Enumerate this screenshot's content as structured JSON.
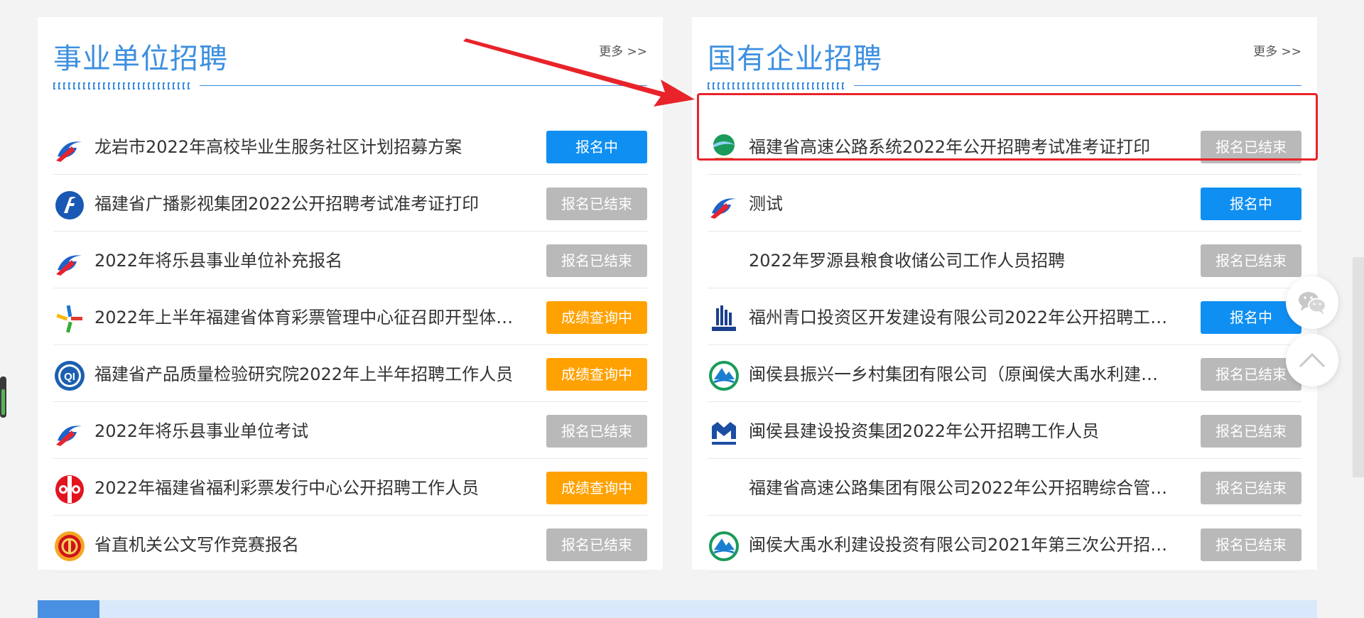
{
  "colors": {
    "brand_blue": "#3d8fe0",
    "status_open": "#0f8ff2",
    "status_ended": "#b9b9b9",
    "status_score": "#ffa100",
    "annotation_red": "#e8232a"
  },
  "panels": {
    "left": {
      "title": "事业单位招聘",
      "more": "更多 >>",
      "items": [
        {
          "title": "龙岩市2022年高校毕业生服务社区计划招募方案",
          "status": "报名中",
          "icon": "blue-red-swoosh-logo"
        },
        {
          "title": "福建省广播影视集团2022公开招聘考试准考证打印",
          "status": "报名已结束",
          "icon": "fujian-broadcast-logo"
        },
        {
          "title": "2022年将乐县事业单位补充报名",
          "status": "报名已结束",
          "icon": "blue-red-swoosh-logo"
        },
        {
          "title": "2022年上半年福建省体育彩票管理中心征召即开型体…",
          "status": "成绩查询中",
          "icon": "sports-lottery-logo"
        },
        {
          "title": "福建省产品质量检验研究院2022年上半年招聘工作人员",
          "status": "成绩查询中",
          "icon": "quality-inspection-logo"
        },
        {
          "title": "2022年将乐县事业单位考试",
          "status": "报名已结束",
          "icon": "blue-red-swoosh-logo"
        },
        {
          "title": "2022年福建省福利彩票发行中心公开招聘工作人员",
          "status": "成绩查询中",
          "icon": "welfare-lottery-logo"
        },
        {
          "title": "省直机关公文写作竞赛报名",
          "status": "报名已结束",
          "icon": "union-emblem-logo"
        }
      ]
    },
    "right": {
      "title": "国有企业招聘",
      "more": "更多 >>",
      "items": [
        {
          "title": "福建省高速公路系统2022年公开招聘考试准考证打印",
          "status": "报名已结束",
          "icon": "expressway-logo"
        },
        {
          "title": "测试",
          "status": "报名中",
          "icon": "blue-red-swoosh-logo"
        },
        {
          "title": "2022年罗源县粮食收储公司工作人员招聘",
          "status": "报名已结束",
          "icon": ""
        },
        {
          "title": "福州青口投资区开发建设有限公司2022年公开招聘工…",
          "status": "报名中",
          "icon": "qingkou-logo"
        },
        {
          "title": "闽侯县振兴一乡村集团有限公司（原闽侯大禹水利建…",
          "status": "报名已结束",
          "icon": "mountain-water-logo"
        },
        {
          "title": "闽侯县建设投资集团2022年公开招聘工作人员",
          "status": "报名已结束",
          "icon": "minhou-construction-logo"
        },
        {
          "title": "福建省高速公路集团有限公司2022年公开招聘综合管…",
          "status": "报名已结束",
          "icon": ""
        },
        {
          "title": "闽侯大禹水利建设投资有限公司2021年第三次公开招…",
          "status": "报名已结束",
          "icon": "mountain-water-logo"
        }
      ]
    }
  },
  "floating": {
    "wechat_icon": "wechat-icon",
    "top_icon": "back-to-top-icon"
  }
}
